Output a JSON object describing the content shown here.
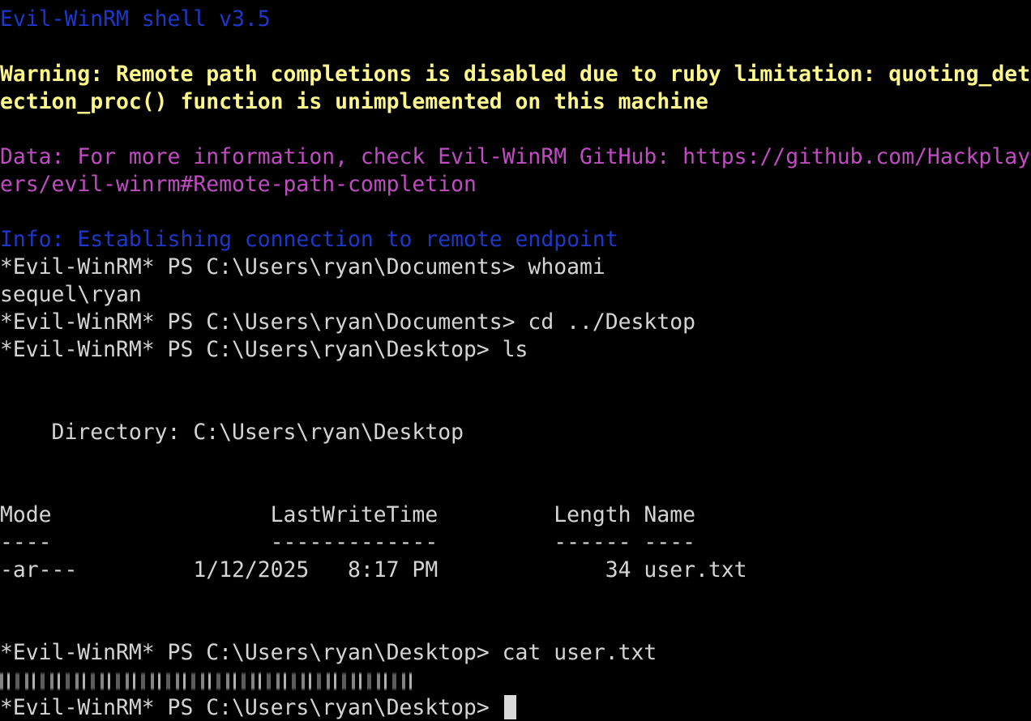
{
  "colors": {
    "background": "#000000",
    "info_blue": "#1f37c8",
    "warning_yellow": "#fdf68a",
    "data_magenta": "#bf4cc0",
    "text_white": "#d4d4d4",
    "cursor": "#d9d9d9"
  },
  "lines": {
    "banner": "Evil-WinRM shell v3.5",
    "warning1": "Warning: Remote path completions is disabled due to ruby limitation: quoting_det",
    "warning2": "ection_proc() function is unimplemented on this machine",
    "data1": "Data: For more information, check Evil-WinRM GitHub: https://github.com/Hackplay",
    "data2": "ers/evil-winrm#Remote-path-completion",
    "info": "Info: Establishing connection to remote endpoint",
    "prompt1": "*Evil-WinRM* PS C:\\Users\\ryan\\Documents> whoami",
    "output_whoami": "sequel\\ryan",
    "prompt2": "*Evil-WinRM* PS C:\\Users\\ryan\\Documents> cd ../Desktop",
    "prompt3": "*Evil-WinRM* PS C:\\Users\\ryan\\Desktop> ls",
    "directory": "    Directory: C:\\Users\\ryan\\Desktop",
    "table_header": "Mode                 LastWriteTime         Length Name",
    "table_rule": "----                 -------------         ------ ----",
    "table_row": "-ar---         1/12/2025   8:17 PM             34 user.txt",
    "prompt4": "*Evil-WinRM* PS C:\\Users\\ryan\\Desktop> cat user.txt",
    "prompt5": "*Evil-WinRM* PS C:\\Users\\ryan\\Desktop> "
  },
  "icons": {
    "cursor": "block-cursor-icon"
  }
}
